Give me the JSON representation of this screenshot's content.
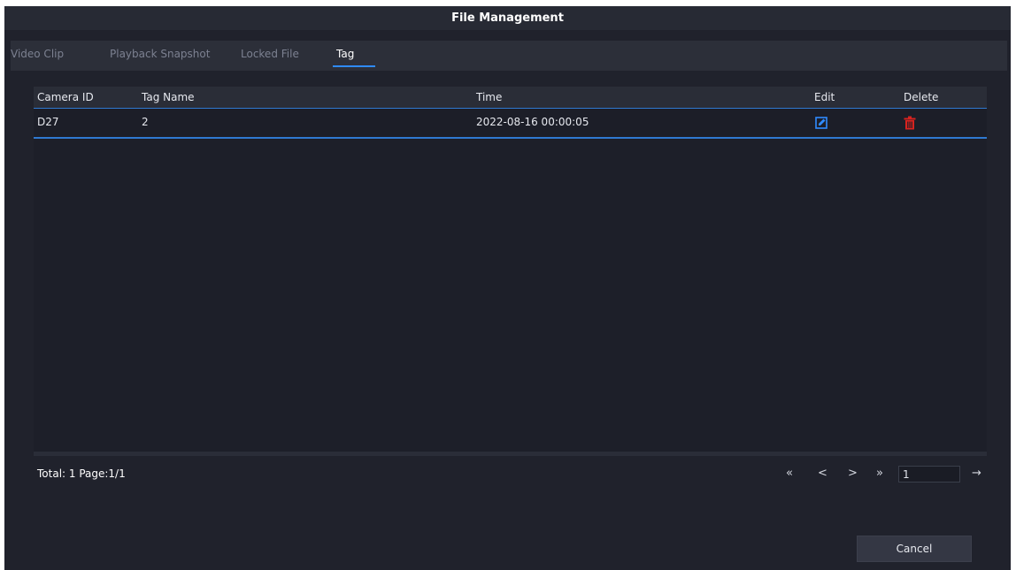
{
  "window": {
    "title": "File Management"
  },
  "tabs": [
    {
      "label": "Video Clip",
      "active": false
    },
    {
      "label": "Playback Snapshot",
      "active": false
    },
    {
      "label": "Locked File",
      "active": false
    },
    {
      "label": "Tag",
      "active": true
    }
  ],
  "table": {
    "columns": [
      "Camera ID",
      "Tag Name",
      "Time",
      "Edit",
      "Delete"
    ],
    "rows": [
      {
        "camera_id": "D27",
        "tag_name": "2",
        "time": "2022-08-16 00:00:05",
        "edit_icon": "edit-icon",
        "delete_icon": "trash-icon"
      }
    ]
  },
  "footer": {
    "total_label": "Total: 1  Page:1/1",
    "first_page": "«",
    "prev_page": "<",
    "next_page": ">",
    "last_page": "»",
    "page_input_value": "1",
    "go": "→"
  },
  "buttons": {
    "cancel": "Cancel"
  },
  "colors": {
    "background": "#20222c",
    "accent": "#2f8bff",
    "edit_icon": "#2f8bff",
    "delete_icon": "#d8231f"
  }
}
